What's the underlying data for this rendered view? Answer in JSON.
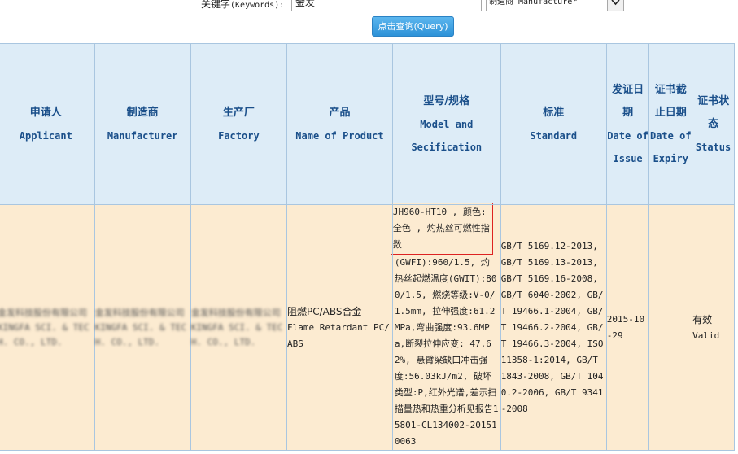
{
  "search": {
    "keywords_label": "关键字",
    "keywords_label_en": "(Keywords):",
    "keyword_value": "金发",
    "type_selected": "制造商 Manufacturer",
    "query_button": "点击查询(Query)"
  },
  "table": {
    "headers": [
      {
        "cn": "申请人",
        "en": "Applicant"
      },
      {
        "cn": "制造商",
        "en": "Manufacturer"
      },
      {
        "cn": "生产厂",
        "en": "Factory"
      },
      {
        "cn": "产品",
        "en": "Name of Product"
      },
      {
        "cn": "型号/规格",
        "en": "Model and Secification"
      },
      {
        "cn": "标准",
        "en": "Standard"
      },
      {
        "cn": "发证日期",
        "en": "Date of Issue"
      },
      {
        "cn": "证书截止日期",
        "en": "Date of Expiry"
      },
      {
        "cn": "证书状态",
        "en": "Status"
      }
    ],
    "row": {
      "applicant": "金发科技股份有限公司 KINGFA SCI. & TECH. CO., LTD.",
      "manufacturer": "金发科技股份有限公司 KINGFA SCI. & TECH. CO., LTD.",
      "factory": "金发科技股份有限公司 KINGFA SCI. & TECH. CO., LTD.",
      "product_cn": "阻燃PC/ABS合金",
      "product_en": "Flame Retardant PC/ABS",
      "model_highlight": "JH960-HT10 , 颜色:全色 , 灼热丝可燃性指数",
      "model_rest": "(GWFI):960/1.5, 灼热丝起燃温度(GWIT):800/1.5, 燃烧等级:V-0/1.5mm, 拉伸强度:61.2MPa,弯曲强度:93.6MPa,断裂拉伸应变: 47.62%, 悬臂梁缺口冲击强度:56.03kJ/m2, 破坏类型:P,红外光谱,差示扫描量热和热重分析见报告15801-CL134002-201510063",
      "standard": "GB/T 5169.12-2013, GB/T 5169.13-2013, GB/T 5169.16-2008, GB/T 6040-2002, GB/T 19466.1-2004, GB/T 19466.2-2004, GB/T 19466.3-2004, ISO 11358-1:2014, GB/T 1843-2008, GB/T 1040.2-2006, GB/T 9341-2008",
      "date_of_issue": "2015-10-29",
      "date_of_expiry": "",
      "status_cn": "有效",
      "status_en": "Valid"
    }
  }
}
